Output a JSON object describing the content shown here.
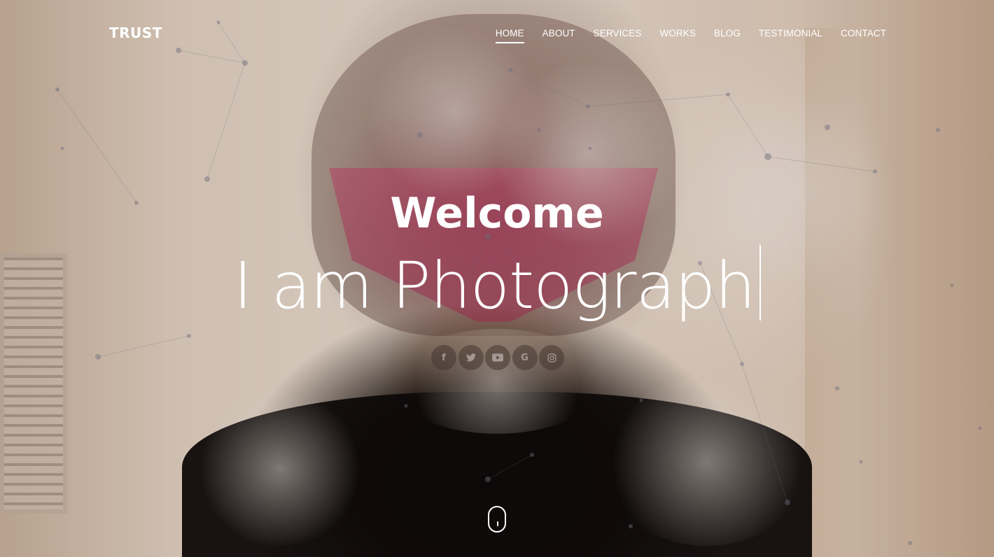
{
  "brand": {
    "name": "TRUST"
  },
  "nav": {
    "items": [
      {
        "label": "HOME",
        "active": true
      },
      {
        "label": "ABOUT",
        "active": false
      },
      {
        "label": "SERVICES",
        "active": false
      },
      {
        "label": "WORKS",
        "active": false
      },
      {
        "label": "BLOG",
        "active": false
      },
      {
        "label": "TESTIMONIAL",
        "active": false
      },
      {
        "label": "CONTACT",
        "active": false
      }
    ]
  },
  "hero": {
    "welcome": "Welcome",
    "tagline": "I am Photograph"
  },
  "social": [
    {
      "icon": "facebook-icon",
      "glyph": "f"
    },
    {
      "icon": "twitter-icon",
      "glyph": ""
    },
    {
      "icon": "youtube-icon",
      "glyph": ""
    },
    {
      "icon": "google-icon",
      "glyph": "G"
    },
    {
      "icon": "instagram-icon",
      "glyph": ""
    }
  ],
  "colors": {
    "text": "#ffffff",
    "social_bg": "#46373266",
    "particle": "#8a8a9a"
  }
}
